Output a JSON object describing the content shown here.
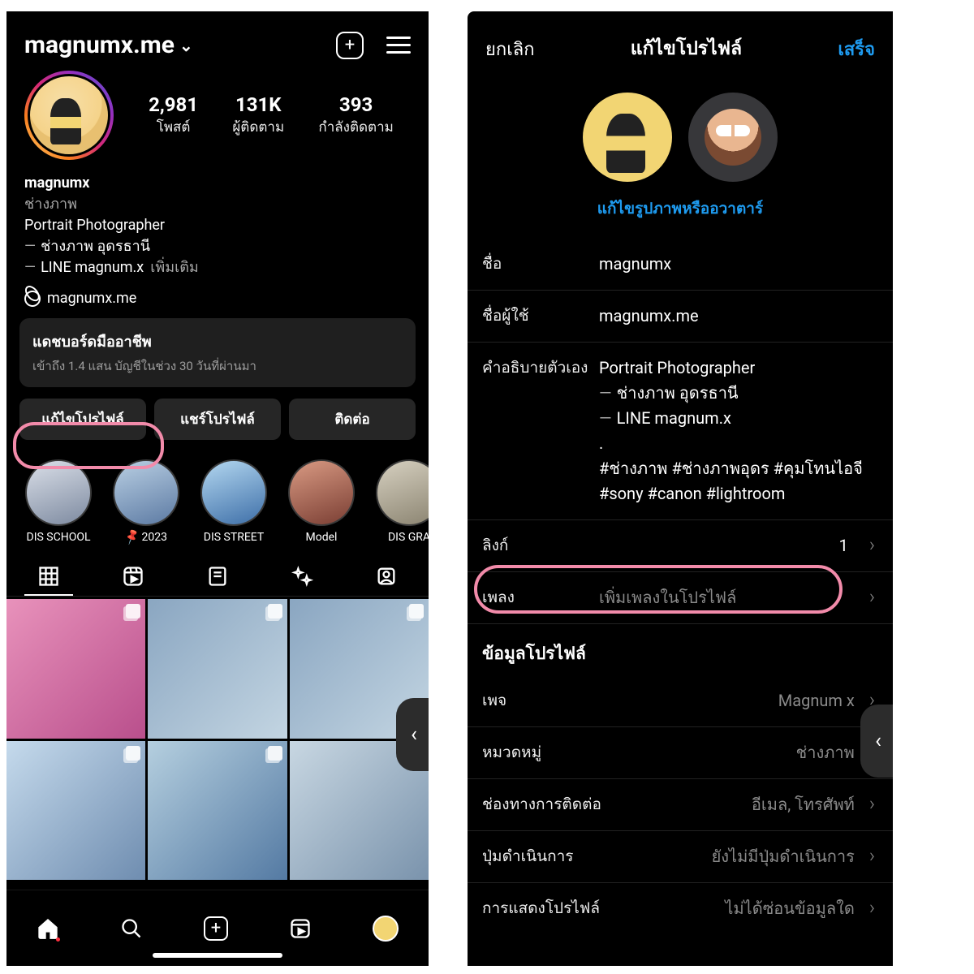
{
  "left": {
    "username": "magnumx.me",
    "stats": {
      "posts": {
        "n": "2,981",
        "l": "โพสต์"
      },
      "followers": {
        "n": "131K",
        "l": "ผู้ติดตาม"
      },
      "following": {
        "n": "393",
        "l": "กำลังติดตาม"
      }
    },
    "bio": {
      "name": "magnumx",
      "category": "ช่างภาพ",
      "line1": "Portrait Photographer",
      "line2": "ช่างภาพ อุดรธานี",
      "line3": "LINE magnum.x",
      "more": "เพิ่มเติม"
    },
    "link": "magnumx.me",
    "dashboard": {
      "title": "แดชบอร์ดมืออาชีพ",
      "sub": "เข้าถึง 1.4 แสน บัญชีในช่วง 30 วันที่ผ่านมา"
    },
    "buttons": {
      "edit": "แก้ไขโปรไฟล์",
      "share": "แชร์โปรไฟล์",
      "contact": "ติดต่อ"
    },
    "highlights": [
      {
        "label": "DIS SCHOOL"
      },
      {
        "label": "2023",
        "pin": true
      },
      {
        "label": "DIS STREET"
      },
      {
        "label": "Model"
      },
      {
        "label": "DIS GRA"
      }
    ]
  },
  "right": {
    "cancel": "ยกเลิก",
    "title": "แก้ไขโปรไฟล์",
    "done": "เสร็จ",
    "editpic": "แก้ไขรูปภาพหรืออวาตาร์",
    "fields": {
      "name": {
        "l": "ชื่อ",
        "v": "magnumx"
      },
      "username": {
        "l": "ชื่อผู้ใช้",
        "v": "magnumx.me"
      },
      "bio": {
        "l": "คำอธิบายตัวเอง",
        "v1": "Portrait Photographer",
        "v2": "ช่างภาพ อุดรธานี",
        "v3": "LINE magnum.x",
        "v4": ".",
        "v5": "#ช่างภาพ #ช่างภาพอุดร #คุมโทนไอจี #sony #canon #lightroom"
      },
      "links": {
        "l": "ลิงก์",
        "n": "1"
      },
      "music": {
        "l": "เพลง",
        "ph": "เพิ่มเพลงในโปรไฟล์"
      }
    },
    "section": "ข้อมูลโปรไฟล์",
    "info": {
      "page": {
        "l": "เพจ",
        "v": "Magnum x"
      },
      "category": {
        "l": "หมวดหมู่",
        "v": "ช่างภาพ"
      },
      "contact": {
        "l": "ช่องทางการติดต่อ",
        "v": "อีเมล, โทรศัพท์"
      },
      "action": {
        "l": "ปุ่มดำเนินการ",
        "v": "ยังไม่มีปุ่มดำเนินการ"
      },
      "display": {
        "l": "การแสดงโปรไฟล์",
        "v": "ไม่ได้ซ่อนข้อมูลใด"
      }
    }
  }
}
